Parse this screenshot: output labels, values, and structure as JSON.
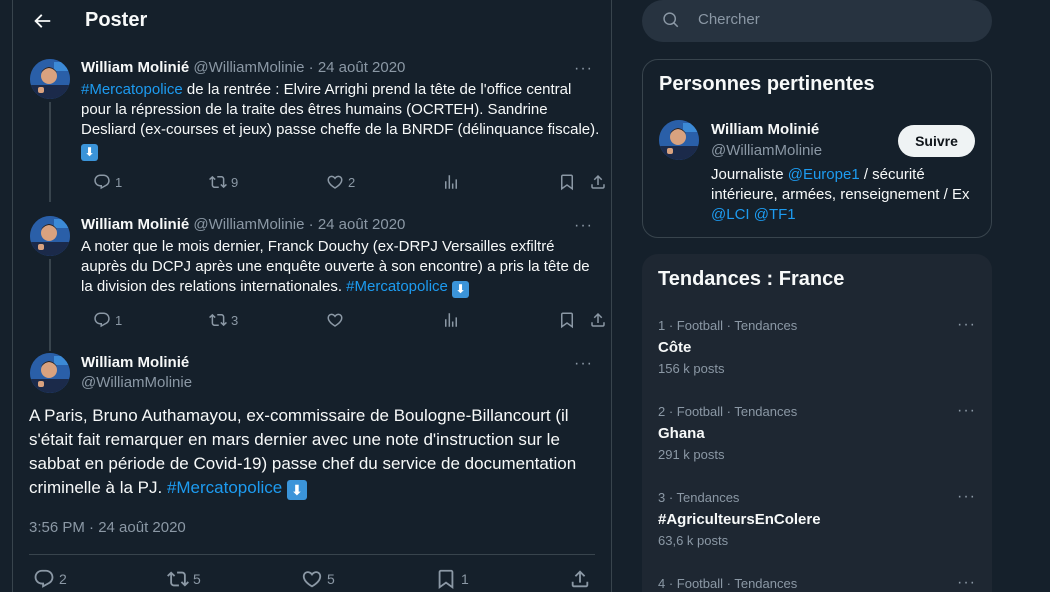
{
  "header": {
    "title": "Poster"
  },
  "colors": {
    "background": "#15202b",
    "accent": "#1d9bf0",
    "muted": "#8b98a5",
    "border": "#38444d"
  },
  "tweets": [
    {
      "name": "William Molinié",
      "handle": "@WilliamMolinie",
      "sep": "·",
      "date": "24 août 2020",
      "hashtag": "#Mercatopolice",
      "text": " de la rentrée : Elvire Arrighi prend la tête de l'office central pour la répression de la traite des êtres humains (OCRTEH). Sandrine Desliard (ex-courses et jeux) passe cheffe de la BNRDF (délinquance fiscale). ",
      "emoji": "⬇",
      "replies": "1",
      "reposts": "9",
      "likes": "2"
    },
    {
      "name": "William Molinié",
      "handle": "@WilliamMolinie",
      "sep": "·",
      "date": "24 août 2020",
      "text": "A noter que le mois dernier, Franck Douchy (ex-DRPJ Versailles exfiltré auprès du DCPJ après une enquête ouverte à son encontre) a pris la tête de la division des relations internationales. ",
      "hashtag": "#Mercatopolice",
      "emoji": "⬇",
      "replies": "1",
      "reposts": "3",
      "likes": ""
    }
  ],
  "main_tweet": {
    "name": "William Molinié",
    "handle": "@WilliamMolinie",
    "text": "A Paris, Bruno Authamayou, ex-commissaire de Boulogne-Billancourt (il s'était fait remarquer en mars dernier avec une note d'instruction sur le sabbat en période de Covid-19) passe chef du service de documentation criminelle à la PJ. ",
    "hashtag": "#Mercatopolice",
    "emoji": "⬇",
    "timestamp": "3:56 PM · 24 août 2020",
    "replies": "2",
    "reposts": "5",
    "likes": "5",
    "bookmarks": "1"
  },
  "search": {
    "placeholder": "Chercher"
  },
  "relevant": {
    "title": "Personnes pertinentes",
    "name": "William Molinié",
    "handle": "@WilliamMolinie",
    "follow_label": "Suivre",
    "bio_parts": [
      "Journaliste ",
      "@Europe1",
      " / sécurité intérieure, armées, renseignement / Ex ",
      "@LCI",
      " ",
      "@TF1"
    ]
  },
  "trends": {
    "title": "Tendances : France",
    "items": [
      {
        "meta": "1 · Football · Tendances",
        "name": "Côte",
        "posts": "156 k posts"
      },
      {
        "meta": "2 · Football · Tendances",
        "name": "Ghana",
        "posts": "291 k posts"
      },
      {
        "meta": "3 · Tendances",
        "name": "#AgriculteursEnColere",
        "posts": "63,6 k posts"
      },
      {
        "meta": "4 · Football · Tendances",
        "name": "",
        "posts": ""
      }
    ]
  },
  "more_label": "···"
}
